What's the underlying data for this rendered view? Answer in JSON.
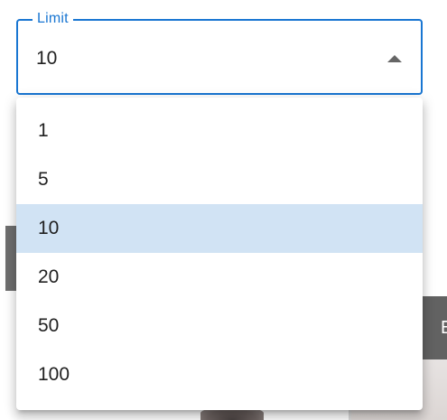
{
  "select": {
    "label": "Limit",
    "value": "10",
    "expanded": true,
    "accent_color": "#1976d2",
    "arrow_icon": "triangle-up-icon"
  },
  "menu": {
    "items": [
      {
        "label": "1",
        "selected": false
      },
      {
        "label": "5",
        "selected": false
      },
      {
        "label": "10",
        "selected": true
      },
      {
        "label": "20",
        "selected": false
      },
      {
        "label": "50",
        "selected": false
      },
      {
        "label": "100",
        "selected": false
      }
    ],
    "selected_color": "#d1e3f4"
  },
  "background": {
    "right_button_text": "E"
  }
}
